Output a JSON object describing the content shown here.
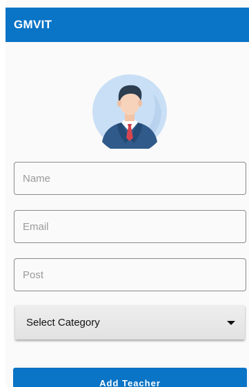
{
  "app_bar": {
    "title": "GMVIT",
    "color": "#0a74c6"
  },
  "avatar": {
    "icon": "teacher-avatar-icon"
  },
  "form": {
    "name_placeholder": "Name",
    "name_value": "",
    "email_placeholder": "Email",
    "email_value": "",
    "post_placeholder": "Post",
    "post_value": "",
    "category_label": "Select Category",
    "category_icon": "dropdown-arrow-icon"
  },
  "actions": {
    "add_label": "Add Teacher"
  }
}
